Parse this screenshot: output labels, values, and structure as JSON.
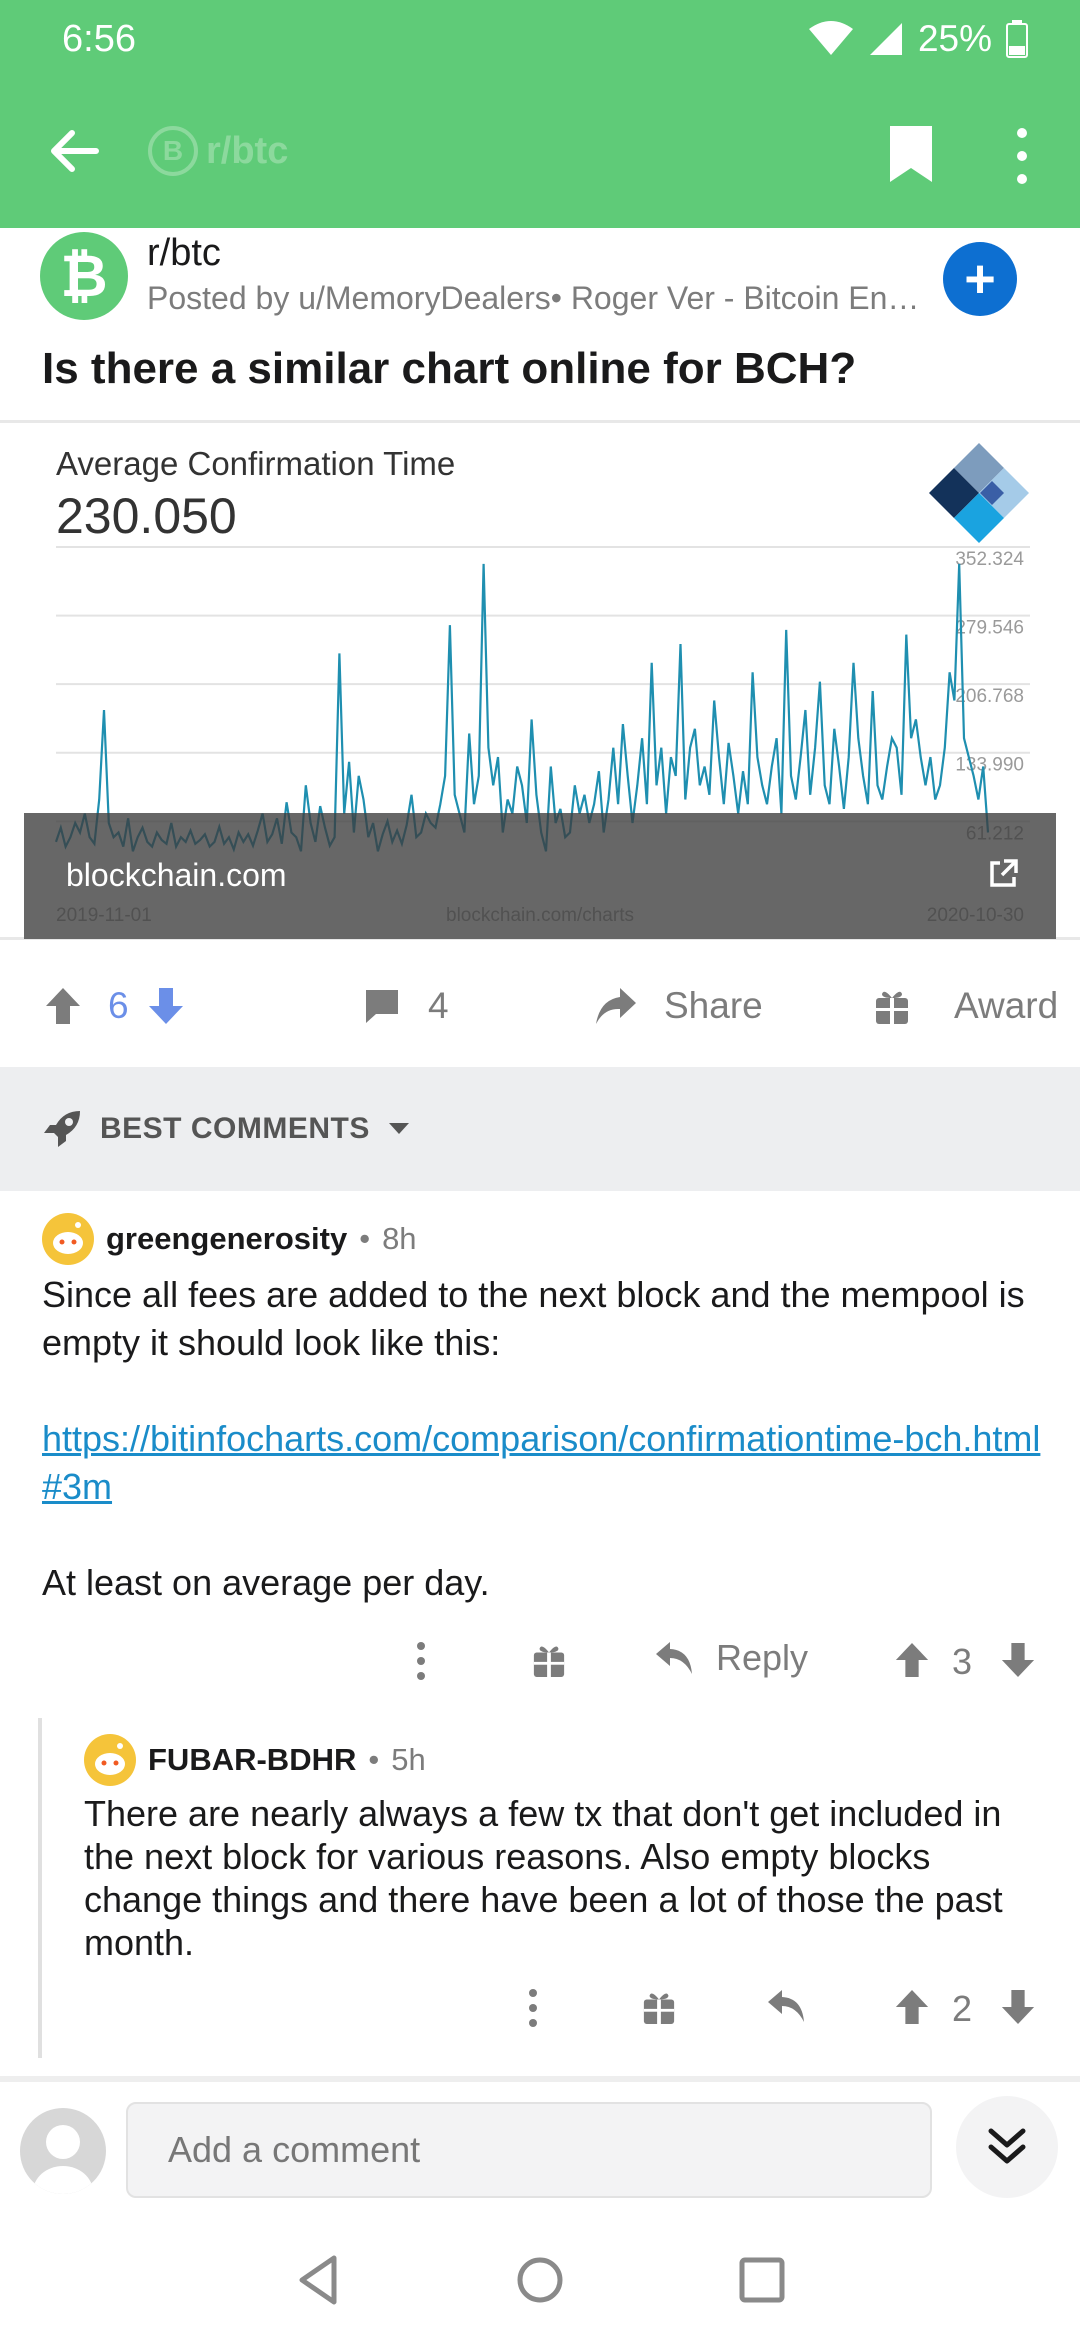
{
  "status": {
    "time": "6:56",
    "battery": "25%"
  },
  "toolbar": {
    "subreddit": "r/btc",
    "sub_letter": "B"
  },
  "post": {
    "subreddit": "r/btc",
    "meta": "Posted by u/MemoryDealers• Roger Ver - Bitcoin Entr...",
    "title": "Is there a similar chart online for BCH?",
    "sub_icon": "₿",
    "join_label": "+"
  },
  "chart": {
    "label": "Average Confirmation Time",
    "value": "230.050",
    "overlay_site": "blockchain.com",
    "footer_url": "blockchain.com/charts",
    "start_date": "2019-11-01",
    "end_date": "2020-10-30"
  },
  "chart_data": {
    "type": "line",
    "title": "Average Confirmation Time",
    "xlabel": "",
    "ylabel": "",
    "x_range": [
      "2019-11-01",
      "2020-10-30"
    ],
    "y_ticks": [
      61.212,
      133.99,
      206.768,
      279.546,
      352.324
    ],
    "y_tick_labels": [
      "61.212",
      "133.990",
      "206.768",
      "279.546",
      "352.324"
    ],
    "ylim": [
      0,
      352.324
    ],
    "grid": true,
    "series": [
      {
        "values": [
          50,
          65,
          45,
          55,
          70,
          60,
          80,
          55,
          48,
          95,
          190,
          70,
          55,
          60,
          45,
          75,
          40,
          55,
          65,
          50,
          45,
          60,
          52,
          48,
          70,
          45,
          55,
          50,
          62,
          48,
          52,
          58,
          45,
          50,
          66,
          48,
          55,
          42,
          60,
          50,
          58,
          46,
          62,
          80,
          50,
          58,
          75,
          48,
          92,
          60,
          55,
          40,
          110,
          70,
          50,
          88,
          65,
          46,
          55,
          250,
          80,
          135,
          60,
          120,
          95,
          55,
          70,
          40,
          58,
          72,
          50,
          62,
          48,
          68,
          100,
          55,
          60,
          80,
          70,
          65,
          90,
          120,
          280,
          100,
          80,
          60,
          165,
          90,
          120,
          345,
          150,
          110,
          140,
          60,
          95,
          80,
          130,
          110,
          70,
          180,
          100,
          60,
          40,
          130,
          70,
          85,
          55,
          60,
          110,
          80,
          100,
          70,
          90,
          125,
          60,
          95,
          150,
          90,
          175,
          120,
          70,
          110,
          160,
          90,
          240,
          110,
          150,
          80,
          140,
          120,
          260,
          95,
          150,
          170,
          110,
          130,
          100,
          200,
          140,
          90,
          155,
          120,
          80,
          125,
          90,
          230,
          140,
          110,
          90,
          130,
          160,
          80,
          275,
          120,
          95,
          140,
          190,
          100,
          150,
          220,
          110,
          90,
          170,
          130,
          85,
          140,
          240,
          160,
          120,
          90,
          210,
          110,
          95,
          130,
          160,
          150,
          100,
          270,
          160,
          180,
          140,
          110,
          140,
          95,
          110,
          150,
          230,
          200,
          345,
          160,
          140,
          120,
          95,
          130,
          60
        ]
      }
    ]
  },
  "actions": {
    "votes": "6",
    "comments": "4",
    "share": "Share",
    "award": "Award"
  },
  "sort": {
    "label": "BEST COMMENTS"
  },
  "comments": [
    {
      "author": "greengenerosity",
      "time": "8h",
      "body_1": "Since all fees are added to the next block and the mempool is empty it should look like this:",
      "link": "https://bitinfocharts.com/comparison/confirmationtime-bch.html#3m",
      "body_2": "At least on average per day.",
      "reply": "Reply",
      "score": "3"
    },
    {
      "author": "FUBAR-BDHR",
      "time": "5h",
      "body": "There are nearly always a few tx that don't get included in the next block for various reasons.  Also empty blocks change things and there have been a lot of those the past month.",
      "score": "2"
    }
  ],
  "compose": {
    "placeholder": "Add a comment"
  },
  "colors": {
    "toolbar": "#5fcb78",
    "link": "#1a8cc9",
    "chart_line": "#1f8fb0",
    "vote_blue": "#6b8fe8"
  }
}
